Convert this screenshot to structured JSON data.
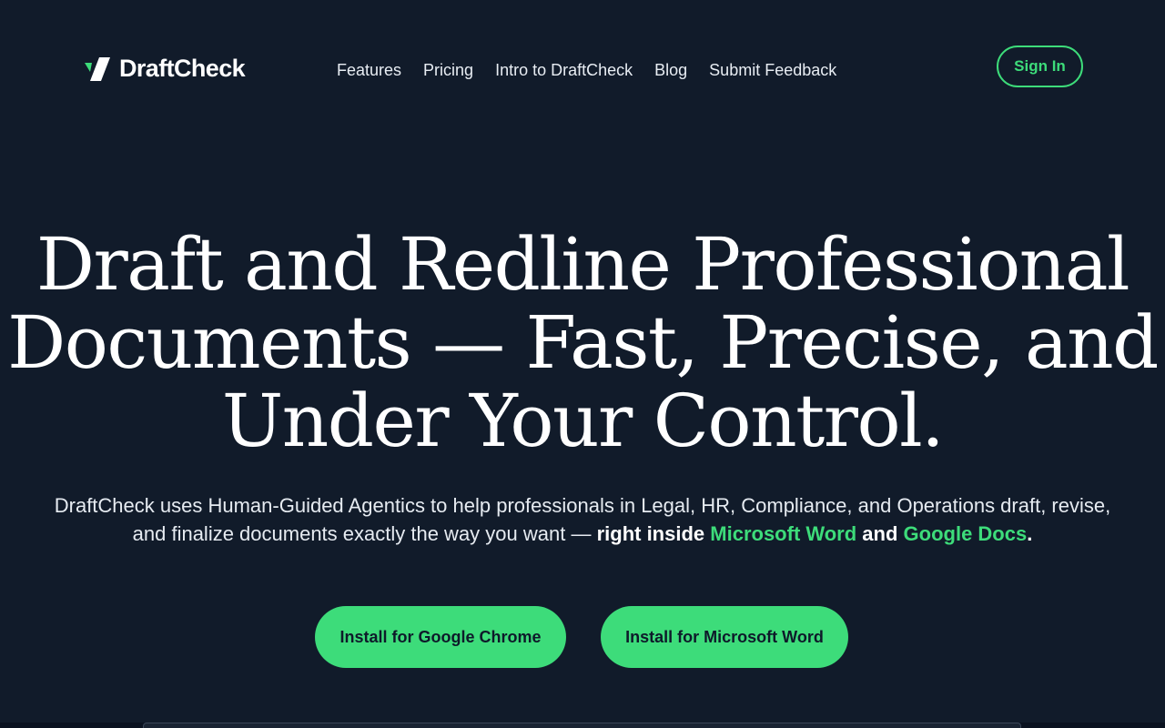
{
  "brand": {
    "name": "DraftCheck",
    "accent": "#3ddc7a",
    "background": "#111b2a"
  },
  "nav": {
    "items": [
      {
        "label": "Features"
      },
      {
        "label": "Pricing"
      },
      {
        "label": "Intro to DraftCheck"
      },
      {
        "label": "Blog"
      },
      {
        "label": "Submit Feedback"
      }
    ],
    "signin_label": "Sign In"
  },
  "hero": {
    "title_line1": "Draft and Redline Professional",
    "title_line2": "Documents — Fast, Precise, and",
    "title_line3": "Under Your Control.",
    "subtitle_plain": "DraftCheck uses Human-Guided Agentics to help professionals in Legal, HR, Compliance, and Operations draft, revise, and finalize documents exactly the way you want — ",
    "subtitle_bold1": "right inside ",
    "subtitle_green1": "Microsoft Word",
    "subtitle_bold2": " and ",
    "subtitle_green2": "Google Docs",
    "subtitle_end": "."
  },
  "cta": {
    "chrome_label": "Install for Google Chrome",
    "word_label": "Install for Microsoft Word"
  }
}
